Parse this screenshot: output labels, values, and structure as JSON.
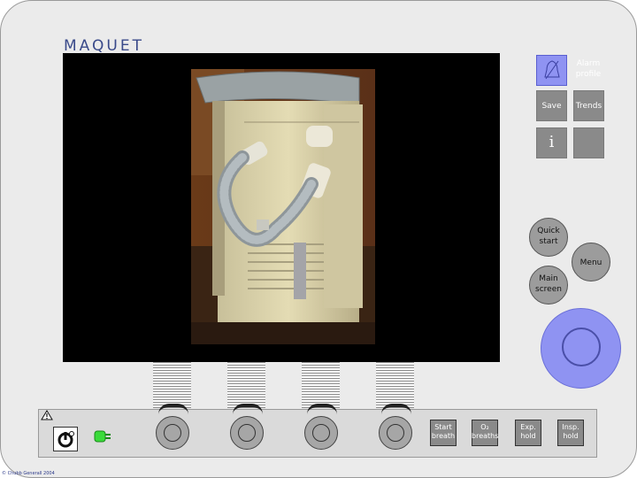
{
  "brand": {
    "logo_text": "MAQUET",
    "accent": "#8f93f2",
    "logo_color": "#3a4a8a"
  },
  "top_buttons": {
    "alarm_profile": {
      "label": "Alarm profile",
      "icon": "bell-icon"
    },
    "save": {
      "label": "Save"
    },
    "trends": {
      "label": "Trends"
    },
    "info": {
      "label": "i",
      "icon": "info-icon"
    },
    "blank": {
      "label": ""
    }
  },
  "round_buttons": {
    "quick_start": "Quick start",
    "menu": "Menu",
    "main_screen": "Main screen"
  },
  "bottom_bar": {
    "warning_icon": "warning-triangle-icon",
    "power_icon": "power-icon",
    "battery_icon": "battery-plug-icon",
    "buttons": {
      "start_breath": "Start breath",
      "o2_breaths": "O₂ breaths",
      "exp_hold": "Exp. hold",
      "insp_hold": "Insp. hold"
    }
  },
  "photo": {
    "subject": "ventilator-photo"
  },
  "copyright": "© Chubb Generall 2004"
}
